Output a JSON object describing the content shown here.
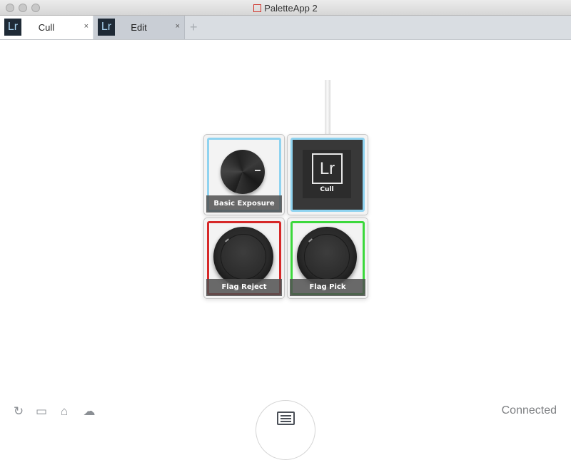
{
  "window": {
    "title": "PaletteApp 2"
  },
  "tabs": [
    {
      "label": "Cull",
      "badge": "Lr",
      "close": "×",
      "active": true
    },
    {
      "label": "Edit",
      "badge": "Lr",
      "close": "×",
      "active": false
    }
  ],
  "add_tab_label": "+",
  "modules": {
    "dial": {
      "label": "Basic Exposure",
      "frame_color": "#8fd3f0"
    },
    "core": {
      "label": "Cull",
      "logo": "Lr",
      "frame_color": "#8fd3f0"
    },
    "button_reject": {
      "label": "Flag Reject",
      "frame_color": "#d62828"
    },
    "button_pick": {
      "label": "Flag Pick",
      "frame_color": "#3cd83c"
    }
  },
  "toolbar": {
    "refresh_icon": "↻",
    "save_icon": "▭",
    "open_icon": "⌂",
    "cloud_icon": "☁"
  },
  "status": "Connected"
}
